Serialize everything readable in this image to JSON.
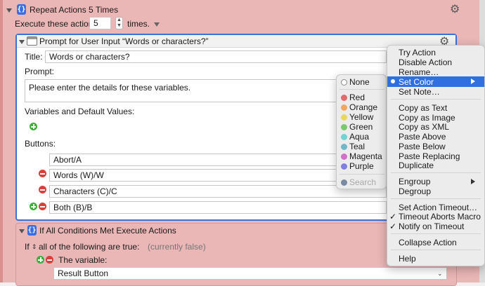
{
  "repeat_action": {
    "title": "Repeat Actions 5 Times",
    "execute_label": "Execute these actions",
    "count_value": "5",
    "times_label": "times."
  },
  "prompt_action": {
    "title": "Prompt for User Input “Words or characters?”",
    "title_label": "Title:",
    "title_value": "Words or characters?",
    "prompt_label": "Prompt:",
    "prompt_value": "Please enter the details for these variables.",
    "variables_label": "Variables and Default Values:",
    "buttons_label": "Buttons:",
    "buttons": [
      "Abort/A",
      "Words (W)/W",
      "Characters (C)/C",
      "Both (B)/B"
    ]
  },
  "if_action": {
    "title": "If All Conditions Met Execute Actions",
    "if_label": "If",
    "all_label": "all of the following are true:",
    "status": "(currently false)",
    "variable_label": "The variable:",
    "variable_value": "Result Button"
  },
  "color_menu": {
    "items": [
      {
        "label": "None",
        "color": "#ffffff"
      },
      {
        "label": "Red",
        "color": "#e06c6c"
      },
      {
        "label": "Orange",
        "color": "#f0a860"
      },
      {
        "label": "Yellow",
        "color": "#e8d860"
      },
      {
        "label": "Green",
        "color": "#7cc870"
      },
      {
        "label": "Aqua",
        "color": "#70d4d0"
      },
      {
        "label": "Teal",
        "color": "#70b8c8"
      },
      {
        "label": "Magenta",
        "color": "#d070c8"
      },
      {
        "label": "Purple",
        "color": "#8080e0"
      }
    ],
    "search_label": "Search"
  },
  "context_menu": {
    "items": [
      "Try Action",
      "Disable Action",
      "Rename…",
      "Set Color",
      "Set Note…",
      "Copy as Text",
      "Copy as Image",
      "Copy as XML",
      "Paste Above",
      "Paste Below",
      "Paste Replacing",
      "Duplicate",
      "Engroup",
      "Degroup",
      "Set Action Timeout…",
      "Timeout Aborts Macro",
      "Notify on Timeout",
      "Collapse Action",
      "Help"
    ],
    "highlight": "#2f6fe2"
  },
  "colors": {
    "macro_bg": "#eab6b6",
    "selection_border": "#3a71d8"
  }
}
